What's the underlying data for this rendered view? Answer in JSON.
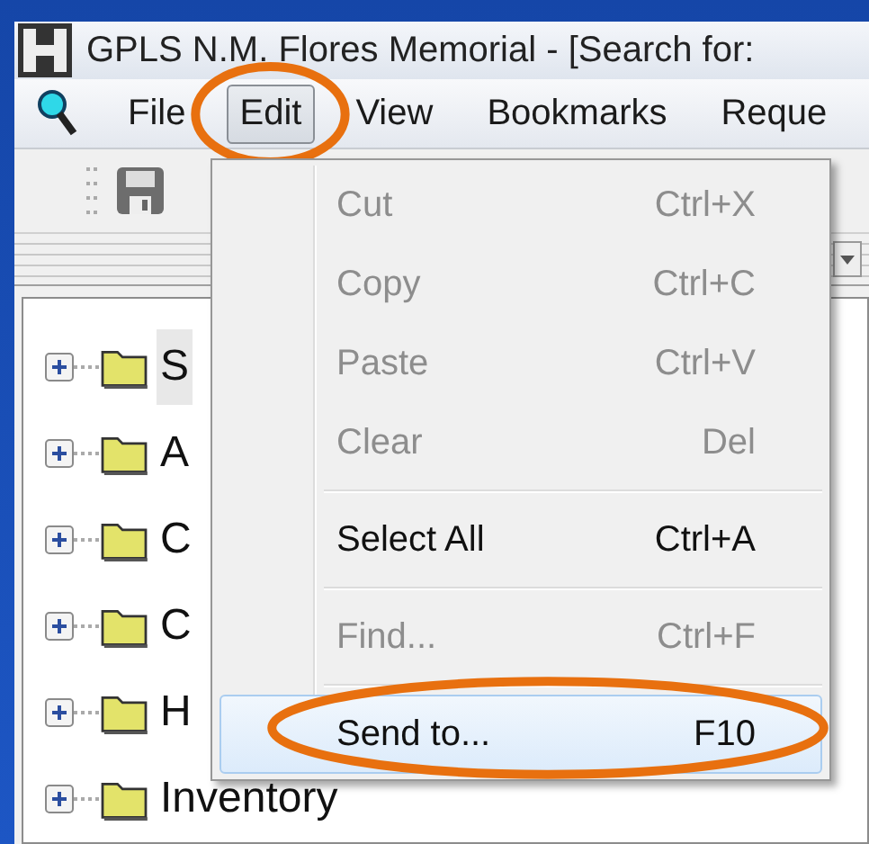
{
  "window": {
    "title": "GPLS N.M. Flores Memorial - [Search for:"
  },
  "menu_bar": [
    {
      "label": "File",
      "open": false,
      "circled": false
    },
    {
      "label": "Edit",
      "open": true,
      "circled": true
    },
    {
      "label": "View",
      "open": false,
      "circled": false
    },
    {
      "label": "Bookmarks",
      "open": false,
      "circled": false
    },
    {
      "label": "Reque",
      "open": false,
      "circled": false
    }
  ],
  "tree": [
    {
      "label": "S",
      "expanded": false,
      "selected": true
    },
    {
      "label": "A",
      "expanded": false,
      "selected": false
    },
    {
      "label": "C",
      "expanded": false,
      "selected": false
    },
    {
      "label": "C",
      "expanded": false,
      "selected": false
    },
    {
      "label": "H",
      "expanded": false,
      "selected": false
    },
    {
      "label": "Inventory",
      "expanded": false,
      "selected": false
    }
  ],
  "edit_menu": [
    {
      "kind": "item",
      "label": "Cut",
      "shortcut": "Ctrl+X",
      "disabled": true,
      "selected": false,
      "circled": false
    },
    {
      "kind": "item",
      "label": "Copy",
      "shortcut": "Ctrl+C",
      "disabled": true,
      "selected": false,
      "circled": false
    },
    {
      "kind": "item",
      "label": "Paste",
      "shortcut": "Ctrl+V",
      "disabled": true,
      "selected": false,
      "circled": false
    },
    {
      "kind": "item",
      "label": "Clear",
      "shortcut": "Del",
      "disabled": true,
      "selected": false,
      "circled": false
    },
    {
      "kind": "separator"
    },
    {
      "kind": "item",
      "label": "Select All",
      "shortcut": "Ctrl+A",
      "disabled": false,
      "selected": false,
      "circled": false
    },
    {
      "kind": "separator"
    },
    {
      "kind": "item",
      "label": "Find...",
      "shortcut": "Ctrl+F",
      "disabled": true,
      "selected": false,
      "circled": false
    },
    {
      "kind": "separator"
    },
    {
      "kind": "item",
      "label": "Send to...",
      "shortcut": "F10",
      "disabled": false,
      "selected": true,
      "circled": true
    }
  ]
}
